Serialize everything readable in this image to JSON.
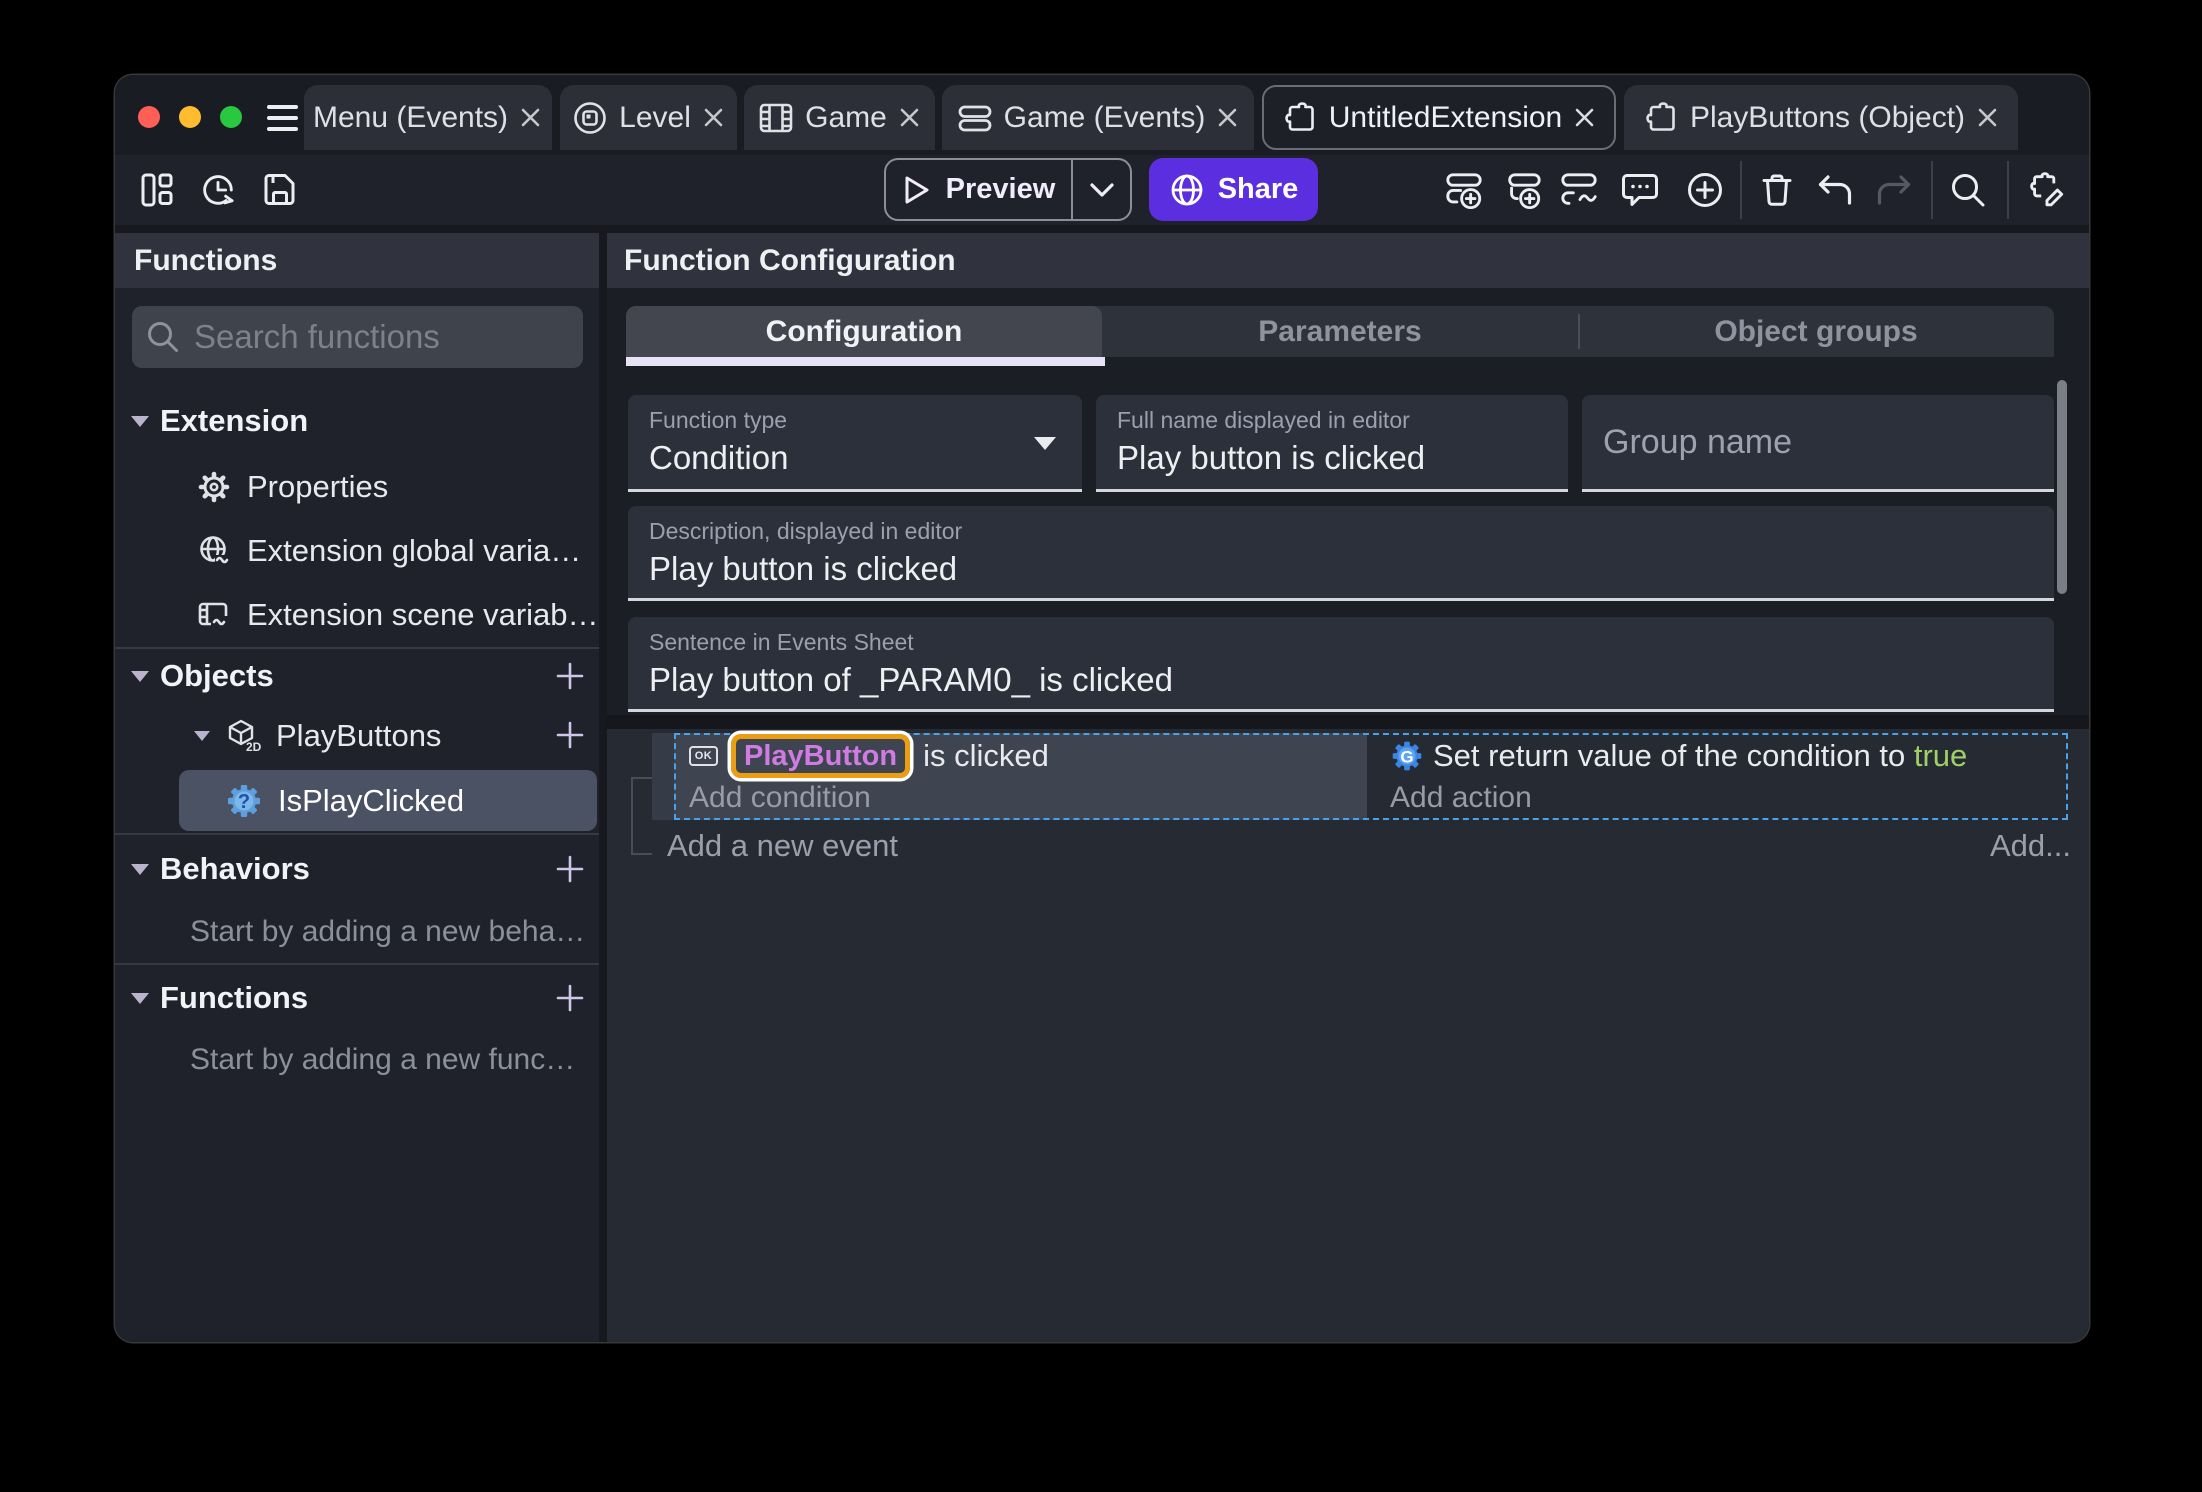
{
  "window_tabs": {
    "items": [
      {
        "label": "Menu (Events)"
      },
      {
        "label": "Level",
        "icon": "scene-icon"
      },
      {
        "label": "Game",
        "icon": "film-icon"
      },
      {
        "label": "Game (Events)",
        "icon": "events-icon"
      },
      {
        "label": "UntitledExtension",
        "icon": "extension-icon",
        "active": true
      },
      {
        "label": "PlayButtons (Object)",
        "icon": "extension-icon"
      }
    ]
  },
  "toolbar": {
    "preview_label": "Preview",
    "share_label": "Share"
  },
  "functions_panel": {
    "title": "Functions",
    "search_placeholder": "Search functions",
    "extension_section": {
      "label": "Extension",
      "items": [
        {
          "label": "Properties"
        },
        {
          "label": "Extension global varia…"
        },
        {
          "label": "Extension scene variab…"
        }
      ]
    },
    "objects_section": {
      "label": "Objects",
      "object": {
        "label": "PlayButtons",
        "badge": "2D"
      },
      "function": {
        "label": "IsPlayClicked"
      }
    },
    "behaviors_section": {
      "label": "Behaviors",
      "empty_text": "Start by adding a new beha…"
    },
    "functions_section": {
      "label": "Functions",
      "empty_text": "Start by adding a new func…"
    }
  },
  "configuration_panel": {
    "title": "Function Configuration",
    "tabs": [
      {
        "label": "Configuration",
        "active": true
      },
      {
        "label": "Parameters"
      },
      {
        "label": "Object groups"
      }
    ],
    "function_type": {
      "label": "Function type",
      "value": "Condition"
    },
    "full_name": {
      "label": "Full name displayed in editor",
      "value": "Play button is clicked"
    },
    "group_name": {
      "label": "Group name",
      "value": ""
    },
    "description": {
      "label": "Description, displayed in editor",
      "value": "Play button is clicked"
    },
    "sentence": {
      "label": "Sentence in Events Sheet",
      "value": "Play button of _PARAM0_ is clicked"
    }
  },
  "events_sheet": {
    "condition": {
      "icon_label": "OK",
      "object_name": "PlayButton",
      "text": "is clicked"
    },
    "add_condition": "Add condition",
    "action": {
      "text": "Set return value of the condition to",
      "value": "true"
    },
    "add_action": "Add action",
    "add_new_event": "Add a new event",
    "add_more": "Add...",
    "colors": {
      "object_name": "#cf7be2",
      "selected_parameter_border": "#eb9d13",
      "selection_border": "#4aa3e8",
      "boolean_true": "#9fd065"
    }
  },
  "accent_colors": {
    "share_button": "#5b2ee0",
    "traffic_close": "#ff5f57",
    "traffic_minimize": "#febc2e",
    "traffic_zoom": "#28c840"
  }
}
